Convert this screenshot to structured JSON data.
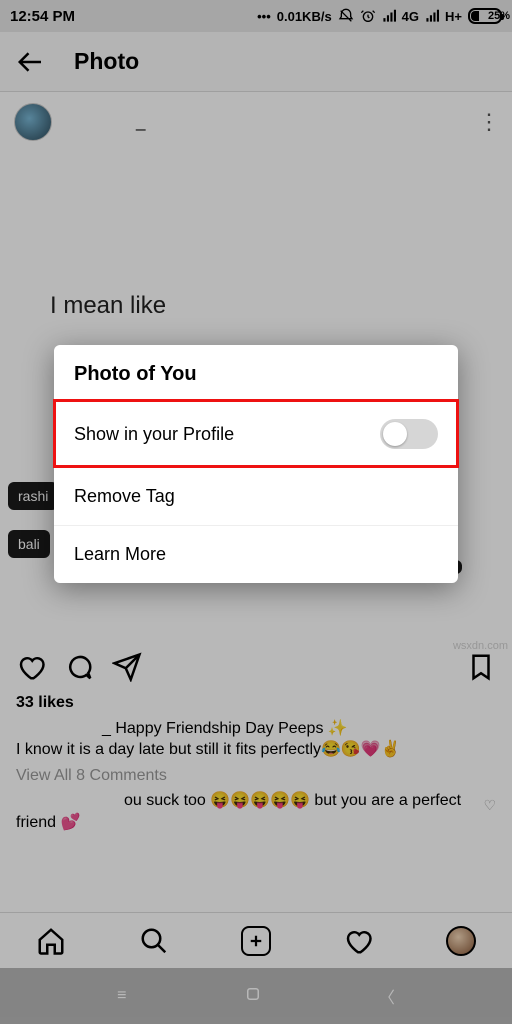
{
  "status": {
    "time": "12:54 PM",
    "speed": "0.01KB/s",
    "net1": "4G",
    "net2": "H+",
    "battery": "25%"
  },
  "header": {
    "title": "Photo"
  },
  "post": {
    "username_tail": "_",
    "image_text": "I mean like",
    "tag1": "rashi",
    "tag2": "bali",
    "likes": "33 likes",
    "caption_tail": "_ Happy Friendship Day Peeps ✨",
    "caption_line2": "I know it is a day late but still it fits perfectly😂😘💗✌️",
    "view_comments": "View All 8 Comments",
    "comment1_tail": "ou suck too 😝😝😝😝😝 but you are a perfect friend 💕"
  },
  "dialog": {
    "title": "Photo of You",
    "row1": "Show in your Profile",
    "row2": "Remove Tag",
    "row3": "Learn More"
  },
  "watermark": "wsxdn.com"
}
